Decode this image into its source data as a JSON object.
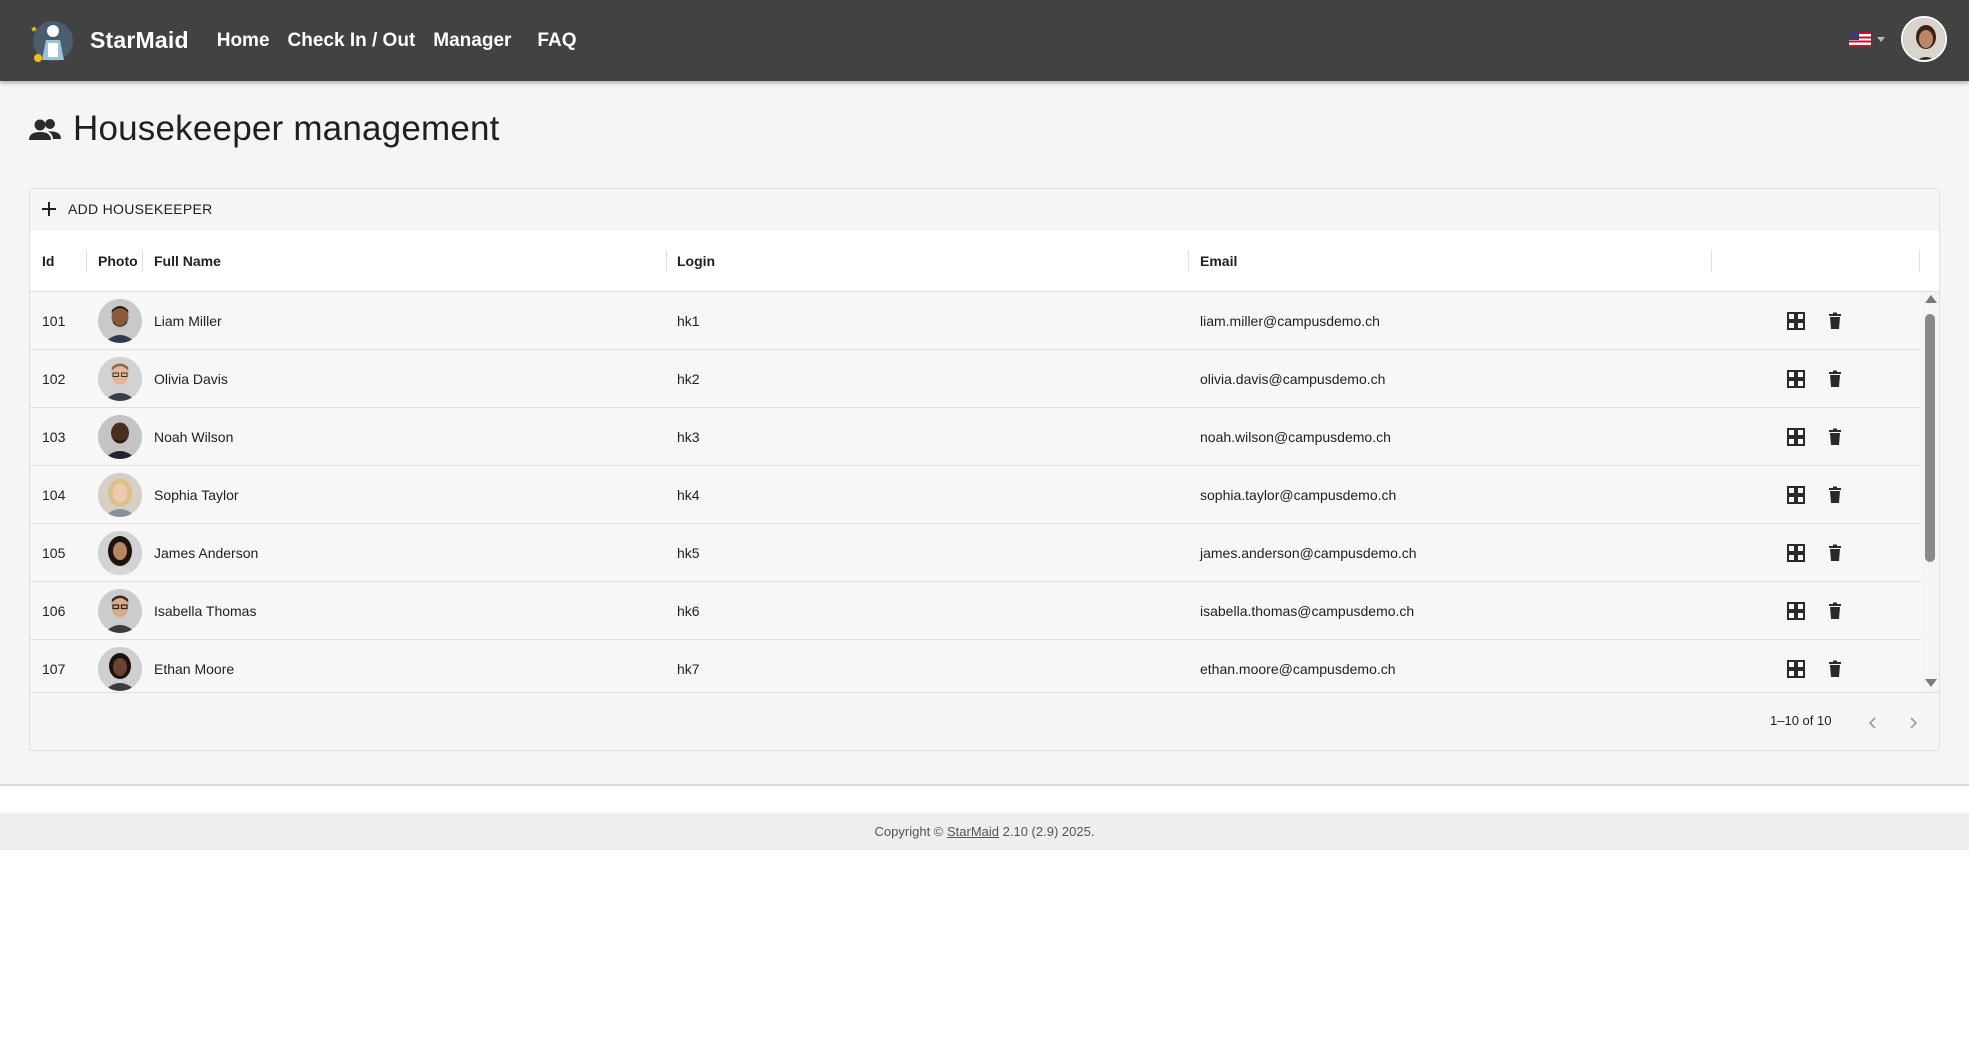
{
  "app": {
    "name": "StarMaid"
  },
  "nav": {
    "home": "Home",
    "checkinout": "Check In / Out",
    "manager": "Manager",
    "faq": "FAQ"
  },
  "language": {
    "flag": "us-flag-icon"
  },
  "page": {
    "title": "Housekeeper management",
    "icon": "people-icon"
  },
  "toolbar": {
    "add_label": "ADD HOUSEKEEPER"
  },
  "columns": {
    "id": "Id",
    "photo": "Photo",
    "fullname": "Full Name",
    "login": "Login",
    "email": "Email"
  },
  "rows": [
    {
      "id": "101",
      "name": "Liam Miller",
      "login": "hk1",
      "email": "liam.miller@campusdemo.ch"
    },
    {
      "id": "102",
      "name": "Olivia Davis",
      "login": "hk2",
      "email": "olivia.davis@campusdemo.ch"
    },
    {
      "id": "103",
      "name": "Noah Wilson",
      "login": "hk3",
      "email": "noah.wilson@campusdemo.ch"
    },
    {
      "id": "104",
      "name": "Sophia Taylor",
      "login": "hk4",
      "email": "sophia.taylor@campusdemo.ch"
    },
    {
      "id": "105",
      "name": "James Anderson",
      "login": "hk5",
      "email": "james.anderson@campusdemo.ch"
    },
    {
      "id": "106",
      "name": "Isabella Thomas",
      "login": "hk6",
      "email": "isabella.thomas@campusdemo.ch"
    },
    {
      "id": "107",
      "name": "Ethan Moore",
      "login": "hk7",
      "email": "ethan.moore@campusdemo.ch"
    }
  ],
  "pagination": {
    "text": "1–10 of 10"
  },
  "footer": {
    "prefix": "Copyright © ",
    "link": "StarMaid",
    "suffix": " 2.10 (2.9) 2025."
  },
  "colors": {
    "topbar": "#424242",
    "background": "#f5f5f5",
    "text": "#1f1f1f"
  }
}
